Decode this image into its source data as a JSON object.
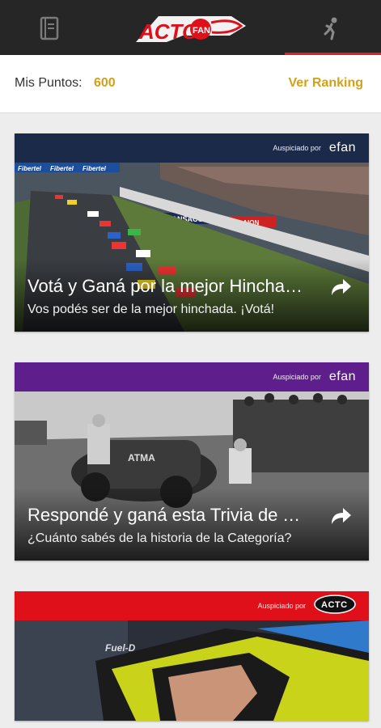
{
  "header": {
    "logo_text": "ACTO",
    "logo_badge": "FAN",
    "left_icon": "book-icon",
    "right_icon": "person-icon",
    "accent": "#e02020"
  },
  "points": {
    "label": "Mis Puntos:",
    "value": "600",
    "ranking_link": "Ver Ranking",
    "accent": "#d4a017"
  },
  "cards": [
    {
      "sponsor_label": "Auspiciado por",
      "sponsor_logo": "efan",
      "sponsor_color": "#1c2a4a",
      "title": "Votá y Ganá por la mejor Hinchada",
      "subtitle": "Vos podés ser de la mejor hinchada. ¡Votá!",
      "image": "race-track-photo",
      "track_banners": [
        "Fibertel",
        "Fibertel",
        "Fibertel",
        "KANSACO",
        "ELAION"
      ]
    },
    {
      "sponsor_label": "Auspiciado por",
      "sponsor_logo": "efan",
      "sponsor_color": "#5e1f8c",
      "title": "Respondé y ganá esta Trivia de TC",
      "subtitle": "¿Cuánto sabés de la historia de la Categoría?",
      "image": "vintage-race-photo",
      "car_label": "ATMA"
    },
    {
      "sponsor_label": "Auspiciado por",
      "sponsor_logo": "ACTC",
      "sponsor_color": "#e0101a",
      "image": "driver-helmet-photo"
    }
  ]
}
